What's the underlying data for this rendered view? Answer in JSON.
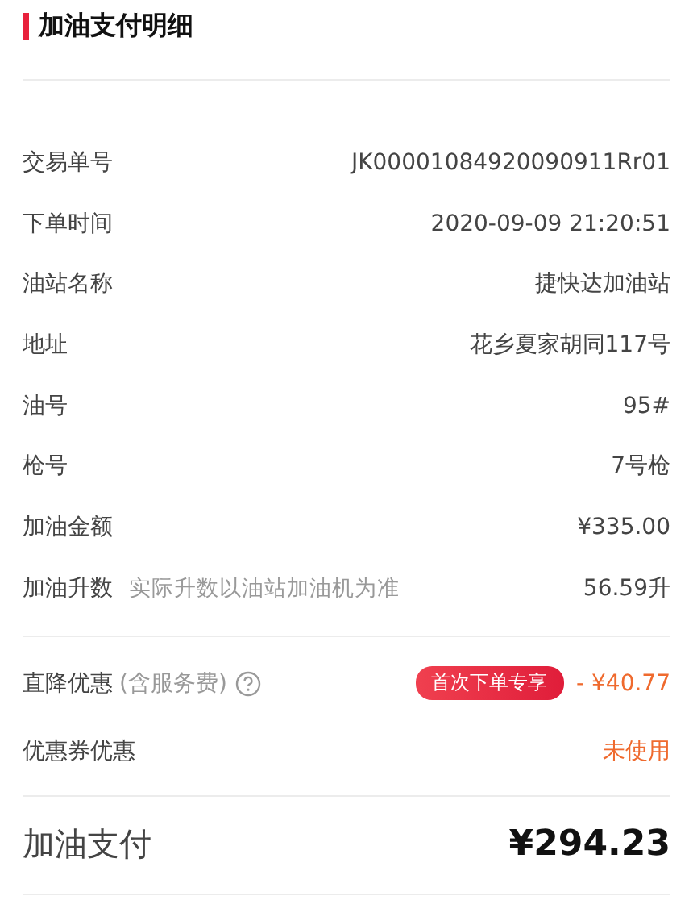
{
  "title": "加油支付明细",
  "details": [
    {
      "label": "交易单号",
      "value": "JK00001084920090911Rr01"
    },
    {
      "label": "下单时间",
      "value": "2020-09-09 21:20:51"
    },
    {
      "label": "油站名称",
      "value": "捷快达加油站"
    },
    {
      "label": "地址",
      "value": "花乡夏家胡同117号"
    },
    {
      "label": "油号",
      "value": "95#"
    },
    {
      "label": "枪号",
      "value": "7号枪"
    },
    {
      "label": "加油金额",
      "value": "¥335.00"
    },
    {
      "label": "加油升数",
      "note": "实际升数以油站加油机为准",
      "value": "56.59升"
    }
  ],
  "discounts": [
    {
      "label": "直降优惠",
      "note": "(含服务费)",
      "help": true,
      "badge": "首次下单专享",
      "value": "- ¥40.77"
    },
    {
      "label": "优惠券优惠",
      "help": false,
      "value": "未使用"
    }
  ],
  "total": {
    "label": "加油支付",
    "value": "¥294.23"
  }
}
